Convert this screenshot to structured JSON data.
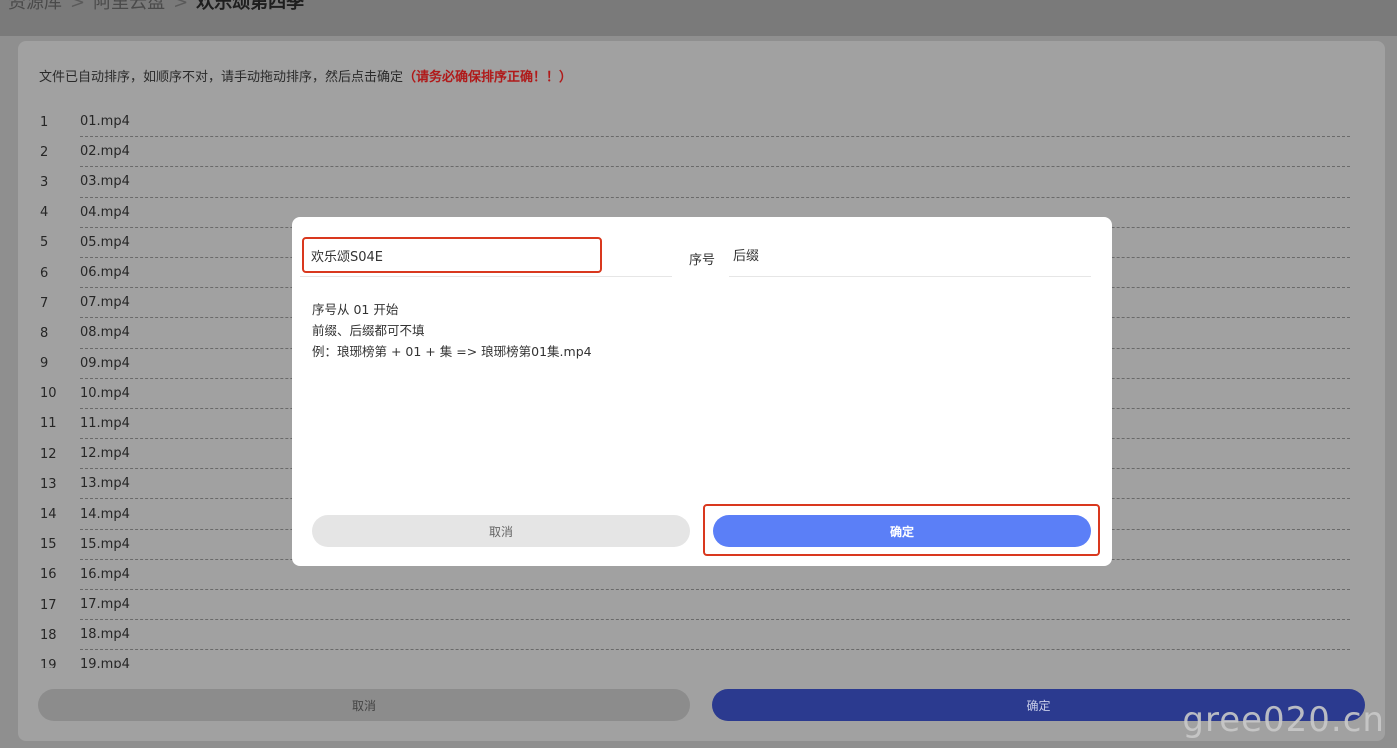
{
  "breadcrumb": {
    "items": [
      "资源库",
      "阿里云盘"
    ],
    "separator": ">",
    "current": "欢乐颂第四季"
  },
  "notice": {
    "text": "文件已自动排序，如顺序不对，请手动拖动排序，然后点击确定",
    "warning": "（请务必确保排序正确！！）"
  },
  "files": [
    {
      "index": "1",
      "name": "01.mp4"
    },
    {
      "index": "2",
      "name": "02.mp4"
    },
    {
      "index": "3",
      "name": "03.mp4"
    },
    {
      "index": "4",
      "name": "04.mp4"
    },
    {
      "index": "5",
      "name": "05.mp4"
    },
    {
      "index": "6",
      "name": "06.mp4"
    },
    {
      "index": "7",
      "name": "07.mp4"
    },
    {
      "index": "8",
      "name": "08.mp4"
    },
    {
      "index": "9",
      "name": "09.mp4"
    },
    {
      "index": "10",
      "name": "10.mp4"
    },
    {
      "index": "11",
      "name": "11.mp4"
    },
    {
      "index": "12",
      "name": "12.mp4"
    },
    {
      "index": "13",
      "name": "13.mp4"
    },
    {
      "index": "14",
      "name": "14.mp4"
    },
    {
      "index": "15",
      "name": "15.mp4"
    },
    {
      "index": "16",
      "name": "16.mp4"
    },
    {
      "index": "17",
      "name": "17.mp4"
    },
    {
      "index": "18",
      "name": "18.mp4"
    },
    {
      "index": "19",
      "name": "19.mp4"
    }
  ],
  "bottom": {
    "cancel_label": "取消",
    "ok_label": "确定"
  },
  "watermark": "gree020.cn",
  "modal": {
    "prefix_value": "欢乐颂S04E",
    "seq_label": "序号",
    "suffix_placeholder": "后缀",
    "hints": [
      "序号从 01 开始",
      "前缀、后缀都可不填",
      "例：琅琊榜第 + 01 + 集 => 琅琊榜第01集.mp4"
    ],
    "cancel_label": "取消",
    "ok_label": "确定"
  },
  "colors": {
    "highlight": "#d9381e",
    "primary": "#5b7ff7",
    "warning_text": "#b01a1a"
  }
}
